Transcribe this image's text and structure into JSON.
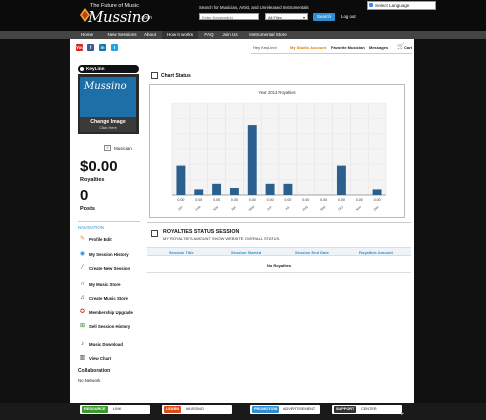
{
  "header": {
    "tagline": "The Future of Music",
    "logo": "Mussino",
    "logo_suffix": ".com",
    "search_caption": "Search for Musician, Artist, and Unreleased Instrumentals",
    "search_placeholder": "Enter Keyword(s)",
    "search_scope": "All Files",
    "search_button": "Search",
    "logout": "Log out",
    "language": "Select Language"
  },
  "nav": [
    "Home",
    "New Sessions",
    "About",
    "How it works",
    "FAQ",
    "Join Us",
    "Instrumental Store"
  ],
  "social": [
    "You",
    "f",
    "in",
    "t"
  ],
  "toplinks": {
    "greeting": "Hey KeyLinn!",
    "studio": "My Studio Account",
    "favorite": "Favorite Musician",
    "messages": "Messages",
    "cart": "Cart"
  },
  "sidebar": {
    "username": "KeyLinn",
    "profile_text": "Mussino",
    "change_image": "Change Image",
    "click_here": "Click Here",
    "role": "Musician",
    "royalties_value": "$0.00",
    "royalties_label": "Royalties",
    "posts_value": "0",
    "posts_label": "Posts",
    "navigation_head": "NAVIGATION",
    "nav_items": [
      {
        "label": "Profile Edit",
        "icon": "pencil-icon"
      },
      {
        "label": "My Session History",
        "icon": "globe-icon"
      },
      {
        "label": "Create New Session",
        "icon": "wand-icon"
      },
      {
        "label": "My Music Store",
        "icon": "headphones-icon"
      },
      {
        "label": "Create Music Store",
        "icon": "notes-icon"
      },
      {
        "label": "Membership Upgrade",
        "icon": "medal-icon"
      },
      {
        "label": "Sell Session History",
        "icon": "cart-icon"
      },
      {
        "label": "Music Download",
        "icon": "music-icon"
      },
      {
        "label": "View Chart",
        "icon": "chart-icon"
      }
    ],
    "collaboration_head": "Collaboration",
    "collaboration_value": "No Network"
  },
  "chart_section": {
    "title": "Chart Status"
  },
  "chart_data": {
    "type": "bar",
    "title": "Year 2013 Royalties",
    "categories": [
      "Jan",
      "Feb",
      "Mar",
      "Apr",
      "May",
      "Jun",
      "Jul",
      "Aug",
      "Sep",
      "Oct",
      "Nov",
      "Dec"
    ],
    "values": [
      0,
      0,
      0,
      0,
      0,
      0,
      0,
      0,
      0,
      0,
      0,
      0
    ],
    "bar_heights_relative": [
      0.42,
      0.08,
      0.16,
      0.1,
      1.0,
      0.16,
      0.16,
      0,
      0,
      0.42,
      0,
      0.08
    ],
    "data_labels": [
      "0.00",
      "0.00",
      "0.00",
      "0.00",
      "0.00",
      "0.00",
      "0.00",
      "0.00",
      "0.00",
      "0.00",
      "0.00",
      "0.00"
    ],
    "color": "#2a5f8e",
    "grid": true
  },
  "royalties_status": {
    "title": "ROYALTIES STATUS SESSION",
    "subtitle": "MY ROYALTIE'S AMOUNT SHOW WEBSITE OVERALL STATUS.",
    "columns": [
      "Session Title",
      "Session Started",
      "Session End Date",
      "Royalties Amount"
    ],
    "empty": "No Royalties"
  },
  "footer": [
    {
      "tag": "RESOURCE",
      "label": "LINK",
      "color": "#3a9a2a"
    },
    {
      "tag": "LEARN",
      "label": "MUSSINO",
      "color": "#e04a1a"
    },
    {
      "tag": "PROMOTION",
      "label": "ADVERTISEMENT",
      "color": "#2e8fd0"
    },
    {
      "tag": "SUPPORT",
      "label": "CENTER",
      "color": "#333333"
    }
  ]
}
